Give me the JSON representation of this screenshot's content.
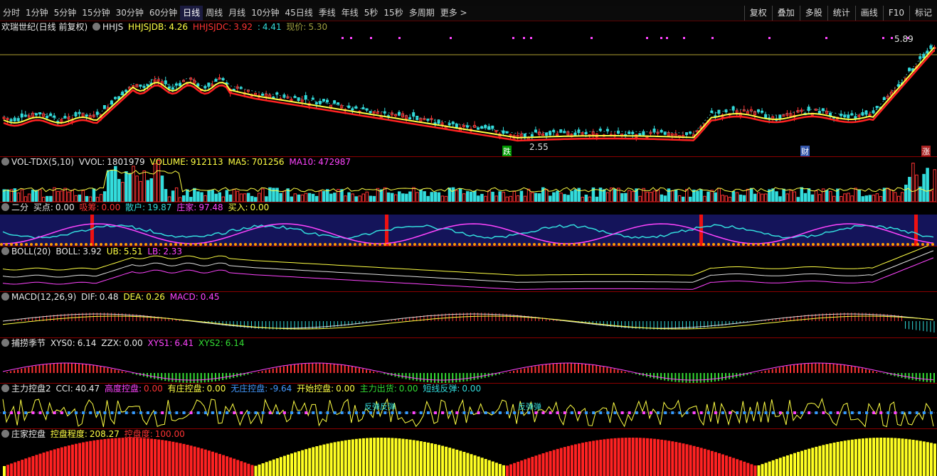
{
  "toolbar": {
    "periods": [
      "分时",
      "1分钟",
      "5分钟",
      "15分钟",
      "30分钟",
      "60分钟",
      "日线",
      "周线",
      "月线",
      "10分钟",
      "45日线",
      "季线",
      "年线",
      "5秒",
      "15秒",
      "多周期",
      "更多 >"
    ],
    "active_period": "日线",
    "right_buttons": [
      "复权",
      "叠加",
      "多股",
      "统计",
      "画线",
      "F10",
      "标记"
    ]
  },
  "main_panel": {
    "stock_name": "欢瑞世纪(日线 前复权)",
    "indicator": "HHJS",
    "label_jdb": "HHJSJDB:",
    "value_jdb": "4.26",
    "label_jdc": "HHJSJDC:",
    "value_jdc": "3.92",
    "label_sep": ":",
    "value_3": "4.41",
    "label_price": "现价:",
    "value_price": "5.30",
    "high_label": "5.89",
    "low_label": "2.55",
    "tag_die": "跌",
    "tag_cai": "财",
    "tag_zhang": "涨"
  },
  "vol_panel": {
    "name": "VOL-TDX(5,10)",
    "vvol_label": "VVOL:",
    "vvol": "1801979",
    "volume_label": "VOLUME:",
    "volume": "912113",
    "ma5_label": "MA5:",
    "ma5": "701256",
    "ma10_label": "MA10:",
    "ma10": "472987"
  },
  "erfen_panel": {
    "name": "二分",
    "buy_label": "买点:",
    "buy": "0.00",
    "xs_label": "吸筹:",
    "xs": "0.00",
    "sh_label": "散户:",
    "sh": "19.87",
    "zj_label": "庄家:",
    "zj": "97.48",
    "mr_label": "买入:",
    "mr": "0.00"
  },
  "boll_panel": {
    "name": "BOLL(20)",
    "boll_label": "BOLL:",
    "boll": "3.92",
    "ub_label": "UB:",
    "ub": "5.51",
    "lb_label": "LB:",
    "lb": "2.33"
  },
  "macd_panel": {
    "name": "MACD(12,26,9)",
    "dif_label": "DIF:",
    "dif": "0.48",
    "dea_label": "DEA:",
    "dea": "0.26",
    "macd_label": "MACD:",
    "macd": "0.45"
  },
  "catch_panel": {
    "name": "捕捞季节",
    "xys0_label": "XYS0:",
    "xys0": "6.14",
    "zzx_label": "ZZX:",
    "zzx": "0.00",
    "xys1_label": "XYS1:",
    "xys1": "6.41",
    "xys2_label": "XYS2:",
    "xys2": "6.14"
  },
  "zlkp_panel": {
    "name": "主力控盘2",
    "cci_label": "CCI:",
    "cci": "40.47",
    "gd_label": "高度控盘:",
    "gd": "0.00",
    "yz_label": "有庄控盘:",
    "yz": "0.00",
    "wz_label": "无庄控盘:",
    "wz": "-9.64",
    "ks_label": "开始控盘:",
    "ks": "0.00",
    "cx_label": "主力出货:",
    "cx": "0.00",
    "dx_label": "短线反弹:",
    "dx": "0.00",
    "rebound_text_1": "反弹反弹",
    "rebound_text_2": "反弹弹"
  },
  "zjkp_panel": {
    "name": "庄家控盘",
    "cd_label": "控盘程度:",
    "cd": "208.27",
    "kp_label": "控盘度:",
    "kp": "100.00"
  },
  "colors": {
    "up": "#ff3333",
    "down": "#33dddd",
    "ma_yellow": "#ffff44",
    "ma_red": "#ff2222",
    "magenta": "#ff44ff",
    "panel_border": "#8b0000"
  }
}
